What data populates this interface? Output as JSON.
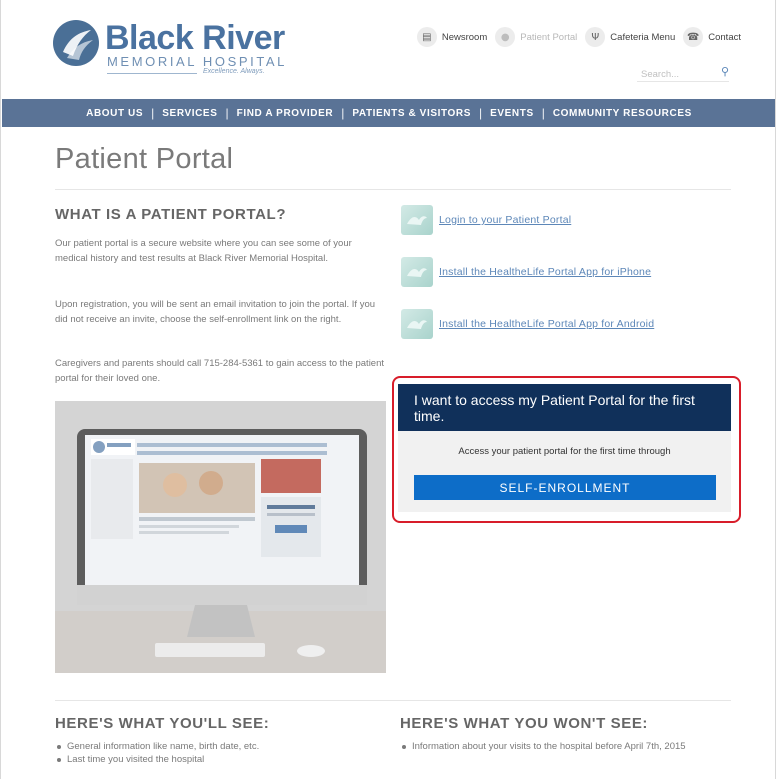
{
  "logo": {
    "name": "Black River",
    "subtitle": "MEMORIAL HOSPITAL",
    "tagline": "Excellence. Always."
  },
  "utility_nav": [
    {
      "label": "Newsroom",
      "icon": "newspaper-icon"
    },
    {
      "label": "Patient Portal",
      "icon": "person-icon"
    },
    {
      "label": "Cafeteria Menu",
      "icon": "utensils-icon"
    },
    {
      "label": "Contact",
      "icon": "phone-icon"
    }
  ],
  "search": {
    "placeholder": "Search...",
    "icon": "search-icon"
  },
  "main_nav": [
    "ABOUT US",
    "SERVICES",
    "FIND A PROVIDER",
    "PATIENTS & VISITORS",
    "EVENTS",
    "COMMUNITY RESOURCES"
  ],
  "page_title": "Patient Portal",
  "what_is": {
    "heading": "WHAT IS A PATIENT PORTAL?",
    "paragraphs": [
      "Our patient portal is a secure website where you can see some of your medical history and test results at Black River Memorial Hospital.",
      "Upon registration, you will be sent an email invitation to join the portal. If you did not receive an invite, choose the self-enrollment link on the right.",
      "Caregivers and parents should call 715-284-5361 to gain access to the patient portal for their loved one."
    ]
  },
  "portal_links": [
    {
      "label": "Login to your Patient Portal",
      "icon": "portal-app-icon"
    },
    {
      "label": "Install the HealtheLife Portal App for iPhone",
      "icon": "portal-app-icon"
    },
    {
      "label": "Install the HealtheLife Portal App for Android",
      "icon": "portal-app-icon"
    }
  ],
  "access_box": {
    "heading": "I want to access my Patient Portal for the first time.",
    "subtext": "Access your patient portal for the first time through",
    "button": "SELF-ENROLLMENT",
    "accent": "#10305a",
    "button_color": "#0d6dc8",
    "highlight_color": "#d81d2a"
  },
  "you_will_see": {
    "heading": "HERE'S WHAT YOU'LL SEE:",
    "items": [
      "General information like name, birth date, etc.",
      "Last time you visited the hospital"
    ]
  },
  "you_wont_see": {
    "heading": "HERE'S WHAT YOU WON'T SEE:",
    "items": [
      "Information about your visits to the hospital before April 7th, 2015"
    ]
  },
  "colors": {
    "nav_bar": "#5a7396",
    "link": "#5d87b8",
    "brand": "#4a72a0"
  }
}
